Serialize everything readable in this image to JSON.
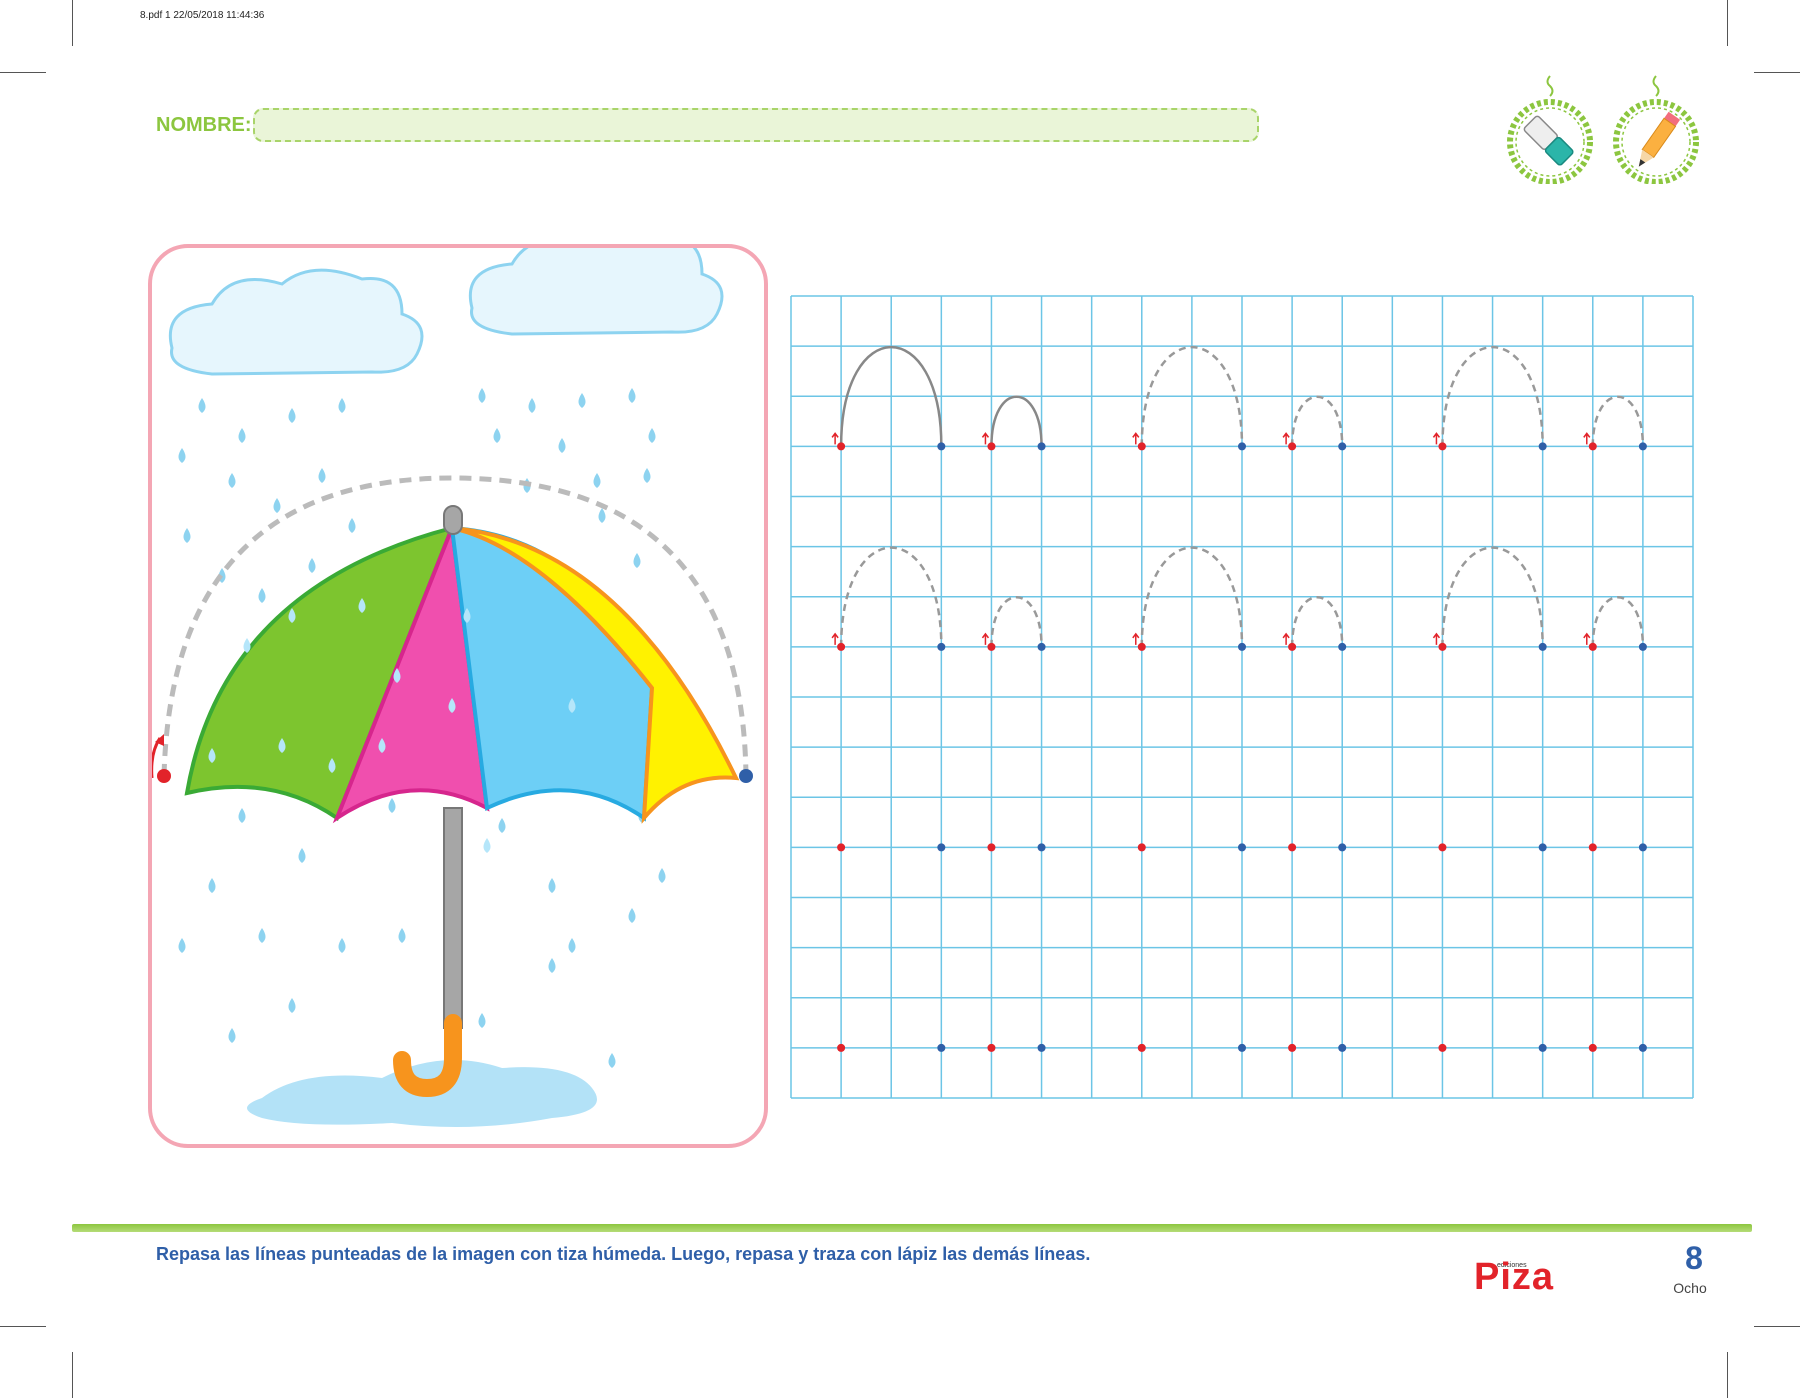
{
  "print_info": "8.pdf   1   22/05/2018   11:44:36",
  "header": {
    "name_label": "NOMBRE:",
    "name_value": "",
    "tools": [
      {
        "icon": "chalk-icon",
        "meaning": "tiza"
      },
      {
        "icon": "pencil-icon",
        "meaning": "lápiz"
      }
    ]
  },
  "illustration": {
    "subject": "umbrella-in-rain",
    "colors": {
      "frame": "#f4a6b4",
      "cloud": "#e6f6fd",
      "drop": "#8dd3f0",
      "panel_green": "#7dc52f",
      "panel_pink": "#f04fae",
      "panel_blue": "#6dcff6",
      "panel_yellow": "#fff200",
      "handle": "#f7941d",
      "start_dot": "#e2232a",
      "end_dot": "#2f5fa8"
    }
  },
  "tracing_grid": {
    "columns": 18,
    "rows": 16,
    "line_color": "#6cc5e6",
    "row_groups": 4,
    "patterns_per_row": 3,
    "group_1_style": "first-solid-then-dashed",
    "group_2_style": "dashed",
    "group_3_style": "dots-only",
    "group_4_style": "dots-only"
  },
  "footer": {
    "instruction": "Repasa las líneas punteadas de la imagen con tiza húmeda. Luego, repasa y traza con lápiz las demás líneas.",
    "publisher_small": "ediciones",
    "publisher": "Piza",
    "page_number": "8",
    "page_word": "Ocho"
  }
}
